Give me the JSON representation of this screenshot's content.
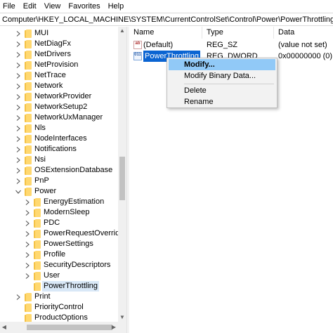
{
  "menu": [
    "File",
    "Edit",
    "View",
    "Favorites",
    "Help"
  ],
  "address_path": "Computer\\HKEY_LOCAL_MACHINE\\SYSTEM\\CurrentControlSet\\Control\\Power\\PowerThrottling",
  "tree": [
    {
      "label": "MUI",
      "level": 0,
      "chevron": "right"
    },
    {
      "label": "NetDiagFx",
      "level": 0,
      "chevron": "right"
    },
    {
      "label": "NetDrivers",
      "level": 0,
      "chevron": "right"
    },
    {
      "label": "NetProvision",
      "level": 0,
      "chevron": "right"
    },
    {
      "label": "NetTrace",
      "level": 0,
      "chevron": "right"
    },
    {
      "label": "Network",
      "level": 0,
      "chevron": "right"
    },
    {
      "label": "NetworkProvider",
      "level": 0,
      "chevron": "right"
    },
    {
      "label": "NetworkSetup2",
      "level": 0,
      "chevron": "right"
    },
    {
      "label": "NetworkUxManager",
      "level": 0,
      "chevron": "right"
    },
    {
      "label": "Nls",
      "level": 0,
      "chevron": "right"
    },
    {
      "label": "NodeInterfaces",
      "level": 0,
      "chevron": "right"
    },
    {
      "label": "Notifications",
      "level": 0,
      "chevron": "right"
    },
    {
      "label": "Nsi",
      "level": 0,
      "chevron": "right"
    },
    {
      "label": "OSExtensionDatabase",
      "level": 0,
      "chevron": "right"
    },
    {
      "label": "PnP",
      "level": 0,
      "chevron": "right"
    },
    {
      "label": "Power",
      "level": 0,
      "chevron": "down"
    },
    {
      "label": "EnergyEstimation",
      "level": 1,
      "chevron": "right"
    },
    {
      "label": "ModernSleep",
      "level": 1,
      "chevron": "right"
    },
    {
      "label": "PDC",
      "level": 1,
      "chevron": "right"
    },
    {
      "label": "PowerRequestOverride",
      "level": 1,
      "chevron": "right"
    },
    {
      "label": "PowerSettings",
      "level": 1,
      "chevron": "right"
    },
    {
      "label": "Profile",
      "level": 1,
      "chevron": "right"
    },
    {
      "label": "SecurityDescriptors",
      "level": 1,
      "chevron": "right"
    },
    {
      "label": "User",
      "level": 1,
      "chevron": "right"
    },
    {
      "label": "PowerThrottling",
      "level": 1,
      "chevron": "none",
      "selected": true
    },
    {
      "label": "Print",
      "level": 0,
      "chevron": "right"
    },
    {
      "label": "PriorityControl",
      "level": 0,
      "chevron": "none"
    },
    {
      "label": "ProductOptions",
      "level": 0,
      "chevron": "none"
    }
  ],
  "columns": {
    "name": "Name",
    "type": "Type",
    "data": "Data"
  },
  "values": [
    {
      "icon": "ab",
      "name": "(Default)",
      "type": "REG_SZ",
      "data": "(value not set)",
      "selected": false
    },
    {
      "icon": "011",
      "name": "PowerThrottling",
      "type": "REG_DWORD",
      "data": "0x00000000 (0)",
      "selected": true
    }
  ],
  "context_menu": {
    "modify": "Modify...",
    "modify_binary": "Modify Binary Data...",
    "delete": "Delete",
    "rename": "Rename"
  },
  "colors": {
    "selection": "#0a64d2",
    "menu_highlight": "#91c9f7",
    "folder": "#f4c245"
  }
}
